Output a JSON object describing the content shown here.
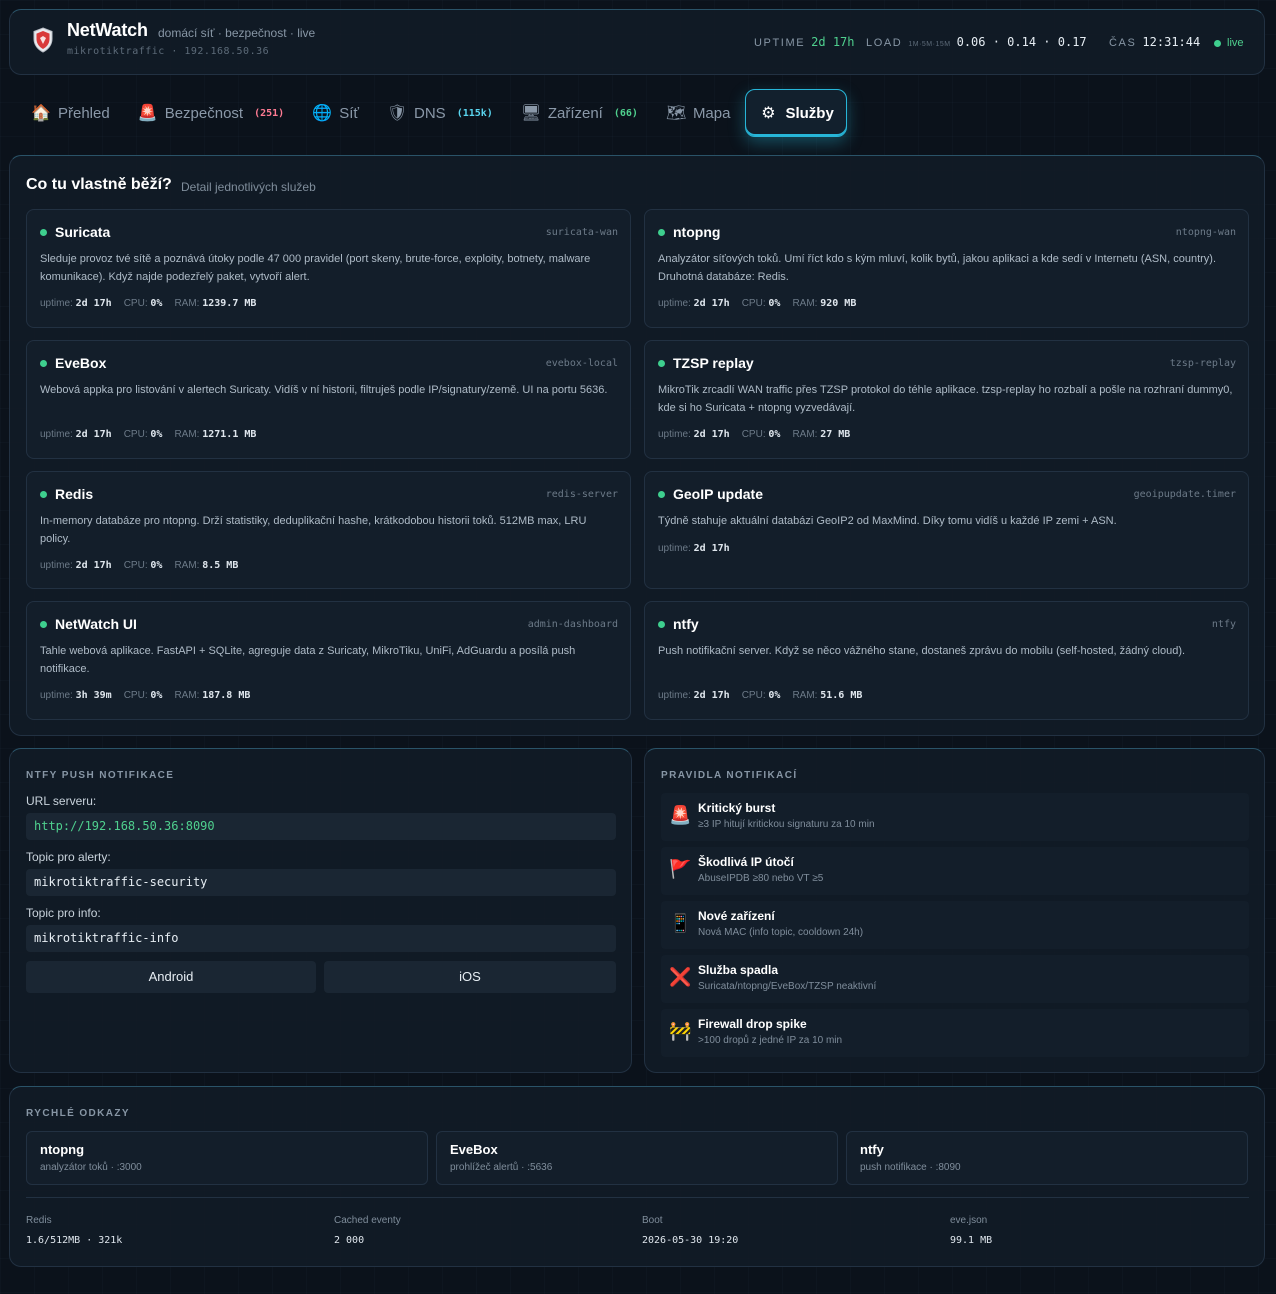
{
  "header": {
    "title": "NetWatch",
    "subtitle": "domácí síť · bezpečnost · live",
    "host": "mikrotiktraffic · 192.168.50.36",
    "uptime_label": "UPTIME",
    "uptime_value": "2d 17h",
    "load_label": "LOAD",
    "load_sub": "1M·5M·15M",
    "load_value": "0.06 · 0.14 · 0.17",
    "time_label": "ČAS",
    "time_value": "12:31:44",
    "live_label": "live"
  },
  "tabs": [
    {
      "icon": "🏠",
      "icon_name": "home-icon",
      "label": "Přehled",
      "badge": "",
      "badge_color": ""
    },
    {
      "icon": "🚨",
      "icon_name": "siren-icon",
      "label": "Bezpečnost",
      "badge": "(251)",
      "badge_color": "#ff7b93"
    },
    {
      "icon": "🌐",
      "icon_name": "globe-icon",
      "label": "Síť",
      "badge": "",
      "badge_color": ""
    },
    {
      "icon": "🛡",
      "icon_name": "shield-icon",
      "label": "DNS",
      "badge": "(115k)",
      "badge_color": "#5ad6f0"
    },
    {
      "icon": "🖥",
      "icon_name": "monitor-icon",
      "label": "Zařízení",
      "badge": "(66)",
      "badge_color": "#4fd08e"
    },
    {
      "icon": "🗺",
      "icon_name": "map-icon",
      "label": "Mapa",
      "badge": "",
      "badge_color": ""
    },
    {
      "icon": "⚙",
      "icon_name": "gear-icon",
      "label": "Služby",
      "badge": "",
      "badge_color": "",
      "active": true
    }
  ],
  "services": {
    "title": "Co tu vlastně běží?",
    "subtitle": "Detail jednotlivých služeb",
    "uptime_label": "uptime:",
    "cpu_label": "CPU:",
    "ram_label": "RAM:",
    "items": [
      {
        "name": "Suricata",
        "unit": "suricata-wan",
        "desc": "Sleduje provoz tvé sítě a poznává útoky podle 47 000 pravidel (port skeny, brute-force, exploity, botnety, malware komunikace). Když najde podezřelý paket, vytvoří alert.",
        "uptime": "2d 17h",
        "cpu": "0%",
        "ram": "1239.7 MB"
      },
      {
        "name": "ntopng",
        "unit": "ntopng-wan",
        "desc": "Analyzátor síťových toků. Umí říct kdo s kým mluví, kolik bytů, jakou aplikaci a kde sedí v Internetu (ASN, country). Druhotná databáze: Redis.",
        "uptime": "2d 17h",
        "cpu": "0%",
        "ram": "920 MB"
      },
      {
        "name": "EveBox",
        "unit": "evebox-local",
        "desc": "Webová appka pro listování v alertech Suricaty. Vidíš v ní historii, filtruješ podle IP/signatury/země. UI na portu 5636.",
        "uptime": "2d 17h",
        "cpu": "0%",
        "ram": "1271.1 MB"
      },
      {
        "name": "TZSP replay",
        "unit": "tzsp-replay",
        "desc": "MikroTik zrcadlí WAN traffic přes TZSP protokol do téhle aplikace. tzsp-replay ho rozbalí a pošle na rozhraní dummy0, kde si ho Suricata + ntopng vyzvedávají.",
        "uptime": "2d 17h",
        "cpu": "0%",
        "ram": "27 MB"
      },
      {
        "name": "Redis",
        "unit": "redis-server",
        "desc": "In-memory databáze pro ntopng. Drží statistiky, deduplikační hashe, krátkodobou historii toků. 512MB max, LRU policy.",
        "uptime": "2d 17h",
        "cpu": "0%",
        "ram": "8.5 MB"
      },
      {
        "name": "GeoIP update",
        "unit": "geoipupdate.timer",
        "desc": "Týdně stahuje aktuální databázi GeoIP2 od MaxMind. Díky tomu vidíš u každé IP zemi + ASN.",
        "uptime": "2d 17h",
        "cpu": "",
        "ram": ""
      },
      {
        "name": "NetWatch UI",
        "unit": "admin-dashboard",
        "desc": "Tahle webová aplikace. FastAPI + SQLite, agreguje data z Suricaty, MikroTiku, UniFi, AdGuardu a posílá push notifikace.",
        "uptime": "3h 39m",
        "cpu": "0%",
        "ram": "187.8 MB"
      },
      {
        "name": "ntfy",
        "unit": "ntfy",
        "desc": "Push notifikační server. Když se něco vážného stane, dostaneš zprávu do mobilu (self-hosted, žádný cloud).",
        "uptime": "2d 17h",
        "cpu": "0%",
        "ram": "51.6 MB"
      }
    ]
  },
  "ntfy": {
    "title": "NTFY PUSH NOTIFIKACE",
    "url_label": "URL serveru:",
    "url_value": "http://192.168.50.36:8090",
    "alert_label": "Topic pro alerty:",
    "alert_value": "mikrotiktraffic-security",
    "info_label": "Topic pro info:",
    "info_value": "mikrotiktraffic-info",
    "android_label": "Android",
    "ios_label": "iOS"
  },
  "rules": {
    "title": "PRAVIDLA NOTIFIKACÍ",
    "items": [
      {
        "icon": "🚨",
        "icon_name": "siren-icon",
        "title": "Kritický burst",
        "sub": "≥3 IP hitují kritickou signaturu za 10 min"
      },
      {
        "icon": "🚩",
        "icon_name": "red-flag-icon",
        "title": "Škodlivá IP útočí",
        "sub": "AbuseIPDB ≥80 nebo VT ≥5"
      },
      {
        "icon": "📱",
        "icon_name": "phone-icon",
        "title": "Nové zařízení",
        "sub": "Nová MAC (info topic, cooldown 24h)"
      },
      {
        "icon": "❌",
        "icon_name": "cross-icon",
        "title": "Služba spadla",
        "sub": "Suricata/ntopng/EveBox/TZSP neaktivní"
      },
      {
        "icon": "🚧",
        "icon_name": "construction-icon",
        "title": "Firewall drop spike",
        "sub": ">100 dropů z jedné IP za 10 min"
      }
    ]
  },
  "links": {
    "title": "RYCHLÉ ODKAZY",
    "items": [
      {
        "title": "ntopng",
        "sub": "analyzátor toků · :3000"
      },
      {
        "title": "EveBox",
        "sub": "prohlížeč alertů · :5636"
      },
      {
        "title": "ntfy",
        "sub": "push notifikace · :8090"
      }
    ],
    "stats": [
      {
        "label": "Redis",
        "value": "1.6/512MB · 321k"
      },
      {
        "label": "Cached eventy",
        "value": "2 000"
      },
      {
        "label": "Boot",
        "value": "2026-05-30 19:20"
      },
      {
        "label": "eve.json",
        "value": "99.1 MB"
      }
    ]
  },
  "colors": {
    "accent": "#27b6d8",
    "status_ok": "#3ecf8e",
    "background": "#0b121b"
  }
}
